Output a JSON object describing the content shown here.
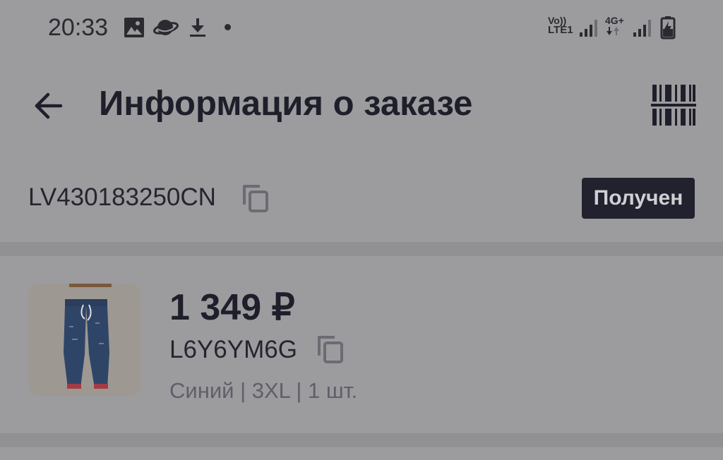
{
  "status_bar": {
    "time": "20:33",
    "left_icons": [
      "image-icon",
      "planet-icon",
      "download-icon",
      "dot-icon"
    ],
    "volte_label": "Vo))",
    "lte_label": "LTE1",
    "network_label": "4G+",
    "right_icons": [
      "signal-icon",
      "signal-icon",
      "battery-charging-icon"
    ]
  },
  "header": {
    "title": "Информация о заказе",
    "back_icon": "arrow-left-icon",
    "barcode_icon": "barcode-scan-icon"
  },
  "order": {
    "tracking_number": "LV430183250CN",
    "status": "Получен"
  },
  "product": {
    "price": "1 349 ₽",
    "sku": "L6Y6YM6G",
    "details": "Синий | 3XL | 1 шт."
  },
  "colors": {
    "background": "#9c9c9f",
    "divider": "#919194",
    "badge": "#22222e",
    "text": "#1f1f2b"
  }
}
